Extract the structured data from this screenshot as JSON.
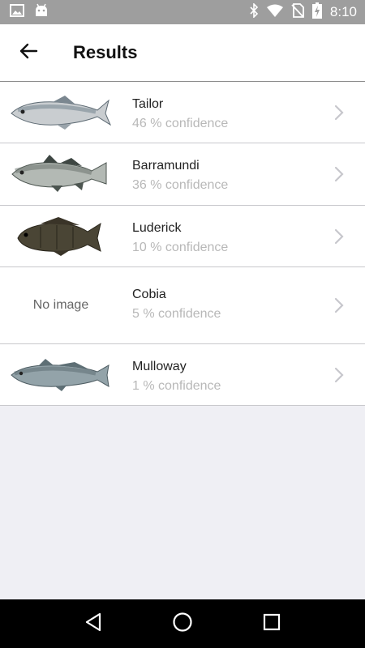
{
  "status_bar": {
    "time": "8:10",
    "icons": [
      "image-icon",
      "android-icon",
      "bluetooth-icon",
      "wifi-icon",
      "no-sim-icon",
      "battery-charging-icon"
    ]
  },
  "app_bar": {
    "back_icon": "arrow-left-icon",
    "title": "Results"
  },
  "results": [
    {
      "name": "Tailor",
      "confidence": "46 % confidence",
      "image": "fish-photo"
    },
    {
      "name": "Barramundi",
      "confidence": "36 % confidence",
      "image": "fish-photo"
    },
    {
      "name": "Luderick",
      "confidence": "10 % confidence",
      "image": "fish-photo"
    },
    {
      "name": "Cobia",
      "confidence": "5 % confidence",
      "image": null,
      "no_image_text": "No image"
    },
    {
      "name": "Mulloway",
      "confidence": "1 % confidence",
      "image": "fish-photo"
    }
  ],
  "nav_bar": {
    "buttons": [
      "back-triangle-icon",
      "home-circle-icon",
      "recents-square-icon"
    ]
  },
  "colors": {
    "status_bar": "#9e9e9e",
    "background": "#efeff4",
    "confidence_text": "#b8b8b8",
    "chevron": "#c7c7cc"
  }
}
